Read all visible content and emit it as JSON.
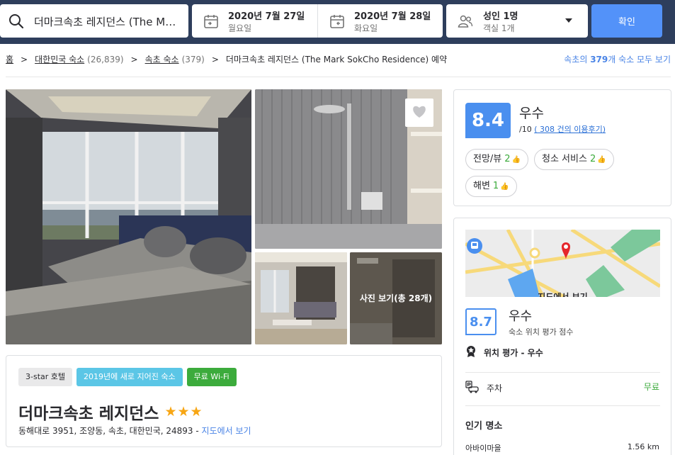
{
  "search": {
    "destination": "더마크속초 레지던스 (The Mark SokCho Residence)",
    "checkin_date": "2020년 7월 27일",
    "checkin_day": "월요일",
    "checkout_date": "2020년 7월 28일",
    "checkout_day": "화요일",
    "guests": "성인 1명",
    "rooms": "객실 1개",
    "submit_label": "확인"
  },
  "breadcrumb": {
    "home": "홈",
    "country": "대한민국 숙소",
    "country_count": "(26,839)",
    "city": "속초 숙소",
    "city_count": "(379)",
    "current": "더마크속초 레지던스 (The Mark SokCho Residence) 예약",
    "view_all_prefix": "속초의",
    "view_all_count": "379",
    "view_all_suffix": "개 숙소 모두 보기"
  },
  "gallery": {
    "more_label": "사진 보기(총 28개)"
  },
  "property": {
    "badges": [
      "3-star 호텔",
      "2019년에 새로 지어진 숙소",
      "무료 Wi-Fi"
    ],
    "name": "더마크속초 레지던스",
    "stars": "★★★",
    "address": "동해대로 3951, 조양동, 속초, 대한민국, 24893 -",
    "map_link": "지도에서 보기"
  },
  "review": {
    "score": "8.4",
    "word": "우수",
    "out_of": "/10",
    "count_link": "( 308 건의 이용후기)",
    "tags": [
      {
        "label": "전망/뷰",
        "count": "2"
      },
      {
        "label": "청소 서비스",
        "count": "2"
      },
      {
        "label": "해변",
        "count": "1"
      }
    ]
  },
  "location": {
    "map_label": "지도에서 보기",
    "score": "8.7",
    "word": "우수",
    "subtitle": "숙소 위치 평가 점수",
    "rating_text": "위치 평가 - 우수",
    "parking_label": "주차",
    "parking_value": "무료",
    "popular_title": "인기 명소",
    "poi_name": "아바이마을",
    "poi_distance": "1.56 km"
  },
  "colors": {
    "header_bg": "#2e3e5c",
    "accent_blue": "#5392f9",
    "score_blue": "#4a8fef",
    "green": "#3cab3c",
    "star": "#f7a614",
    "link": "#4a84e6"
  }
}
